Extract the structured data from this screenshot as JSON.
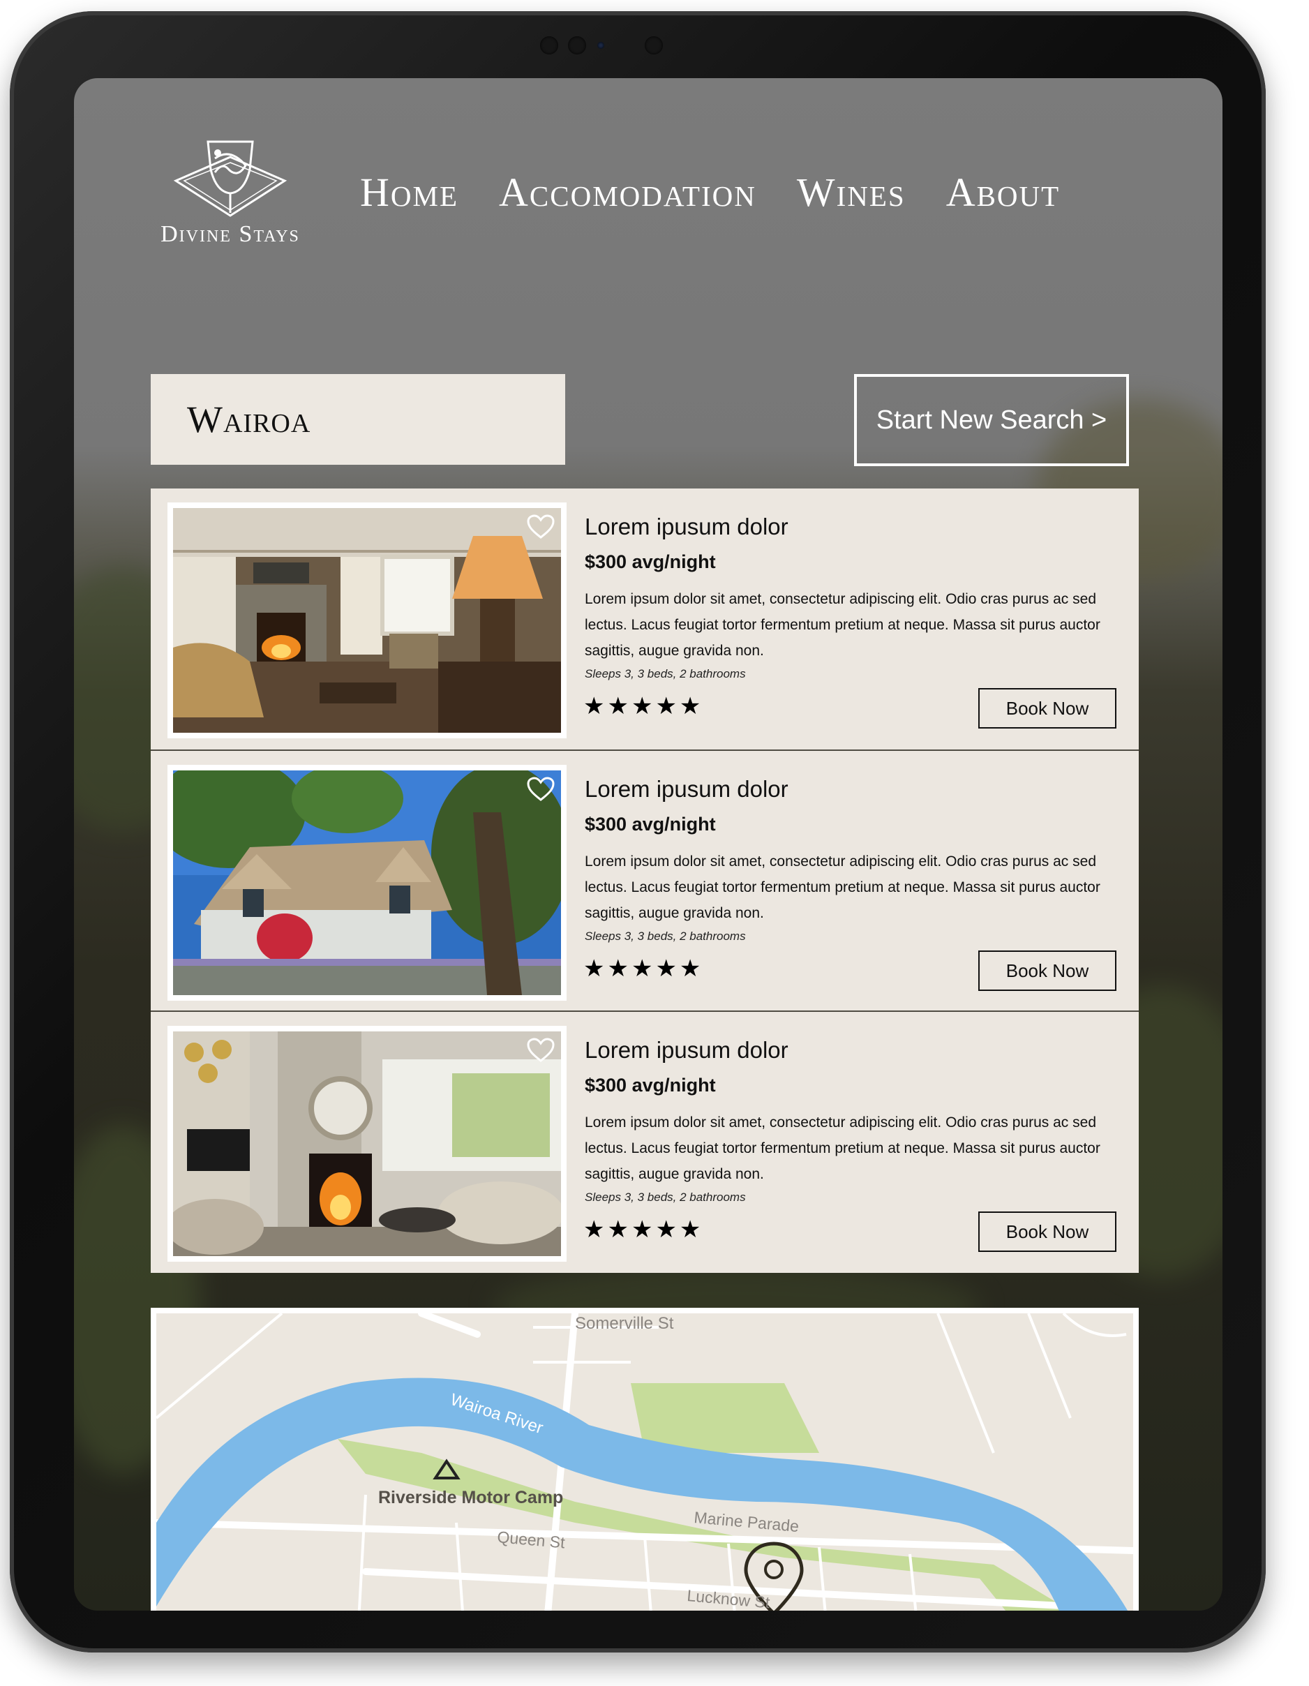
{
  "brand": {
    "name": "Divine Stays"
  },
  "nav": {
    "items": [
      "Home",
      "Accomodation",
      "Wines",
      "About"
    ]
  },
  "search": {
    "location": "Wairoa",
    "new_search_label": "Start New Search >"
  },
  "listings": [
    {
      "title": "Lorem ipusum dolor",
      "price": "$300 avg/night",
      "description": "Lorem ipsum dolor sit amet, consectetur adipiscing elit. Odio cras purus ac sed lectus. Lacus feugiat tortor fermentum pretium at neque. Massa sit purus auctor sagittis, augue gravida non.",
      "sleeps": "Sleeps 3, 3 beds, 2 bathrooms",
      "rating": 5,
      "rating_stars": "★★★★★",
      "book_label": "Book Now"
    },
    {
      "title": "Lorem ipusum dolor",
      "price": "$300 avg/night",
      "description": "Lorem ipsum dolor sit amet, consectetur adipiscing elit. Odio cras purus ac sed lectus. Lacus feugiat tortor fermentum pretium at neque. Massa sit purus auctor sagittis, augue gravida non.",
      "sleeps": "Sleeps 3, 3 beds, 2 bathrooms",
      "rating": 5,
      "rating_stars": "★★★★★",
      "book_label": "Book Now"
    },
    {
      "title": "Lorem ipusum dolor",
      "price": "$300 avg/night",
      "description": "Lorem ipsum dolor sit amet, consectetur adipiscing elit. Odio cras purus ac sed lectus. Lacus feugiat tortor fermentum pretium at neque. Massa sit purus auctor sagittis, augue gravida non.",
      "sleeps": "Sleeps 3, 3 beds, 2 bathrooms",
      "rating": 5,
      "rating_stars": "★★★★★",
      "book_label": "Book Now"
    }
  ],
  "map": {
    "labels": {
      "street_top": "Somerville St",
      "river": "Wairoa River",
      "camp": "Riverside Motor Camp",
      "marine": "Marine Parade",
      "queen": "Queen St",
      "lucknow": "Lucknow St"
    },
    "colors": {
      "land": "#ece7df",
      "water": "#7cb9e8",
      "park": "#c6dc9a",
      "road": "#ffffff"
    }
  },
  "colors": {
    "card_bg": "#ece7e0",
    "location_bg": "#ede8e1",
    "text": "#111111",
    "header_text": "#ffffff"
  }
}
